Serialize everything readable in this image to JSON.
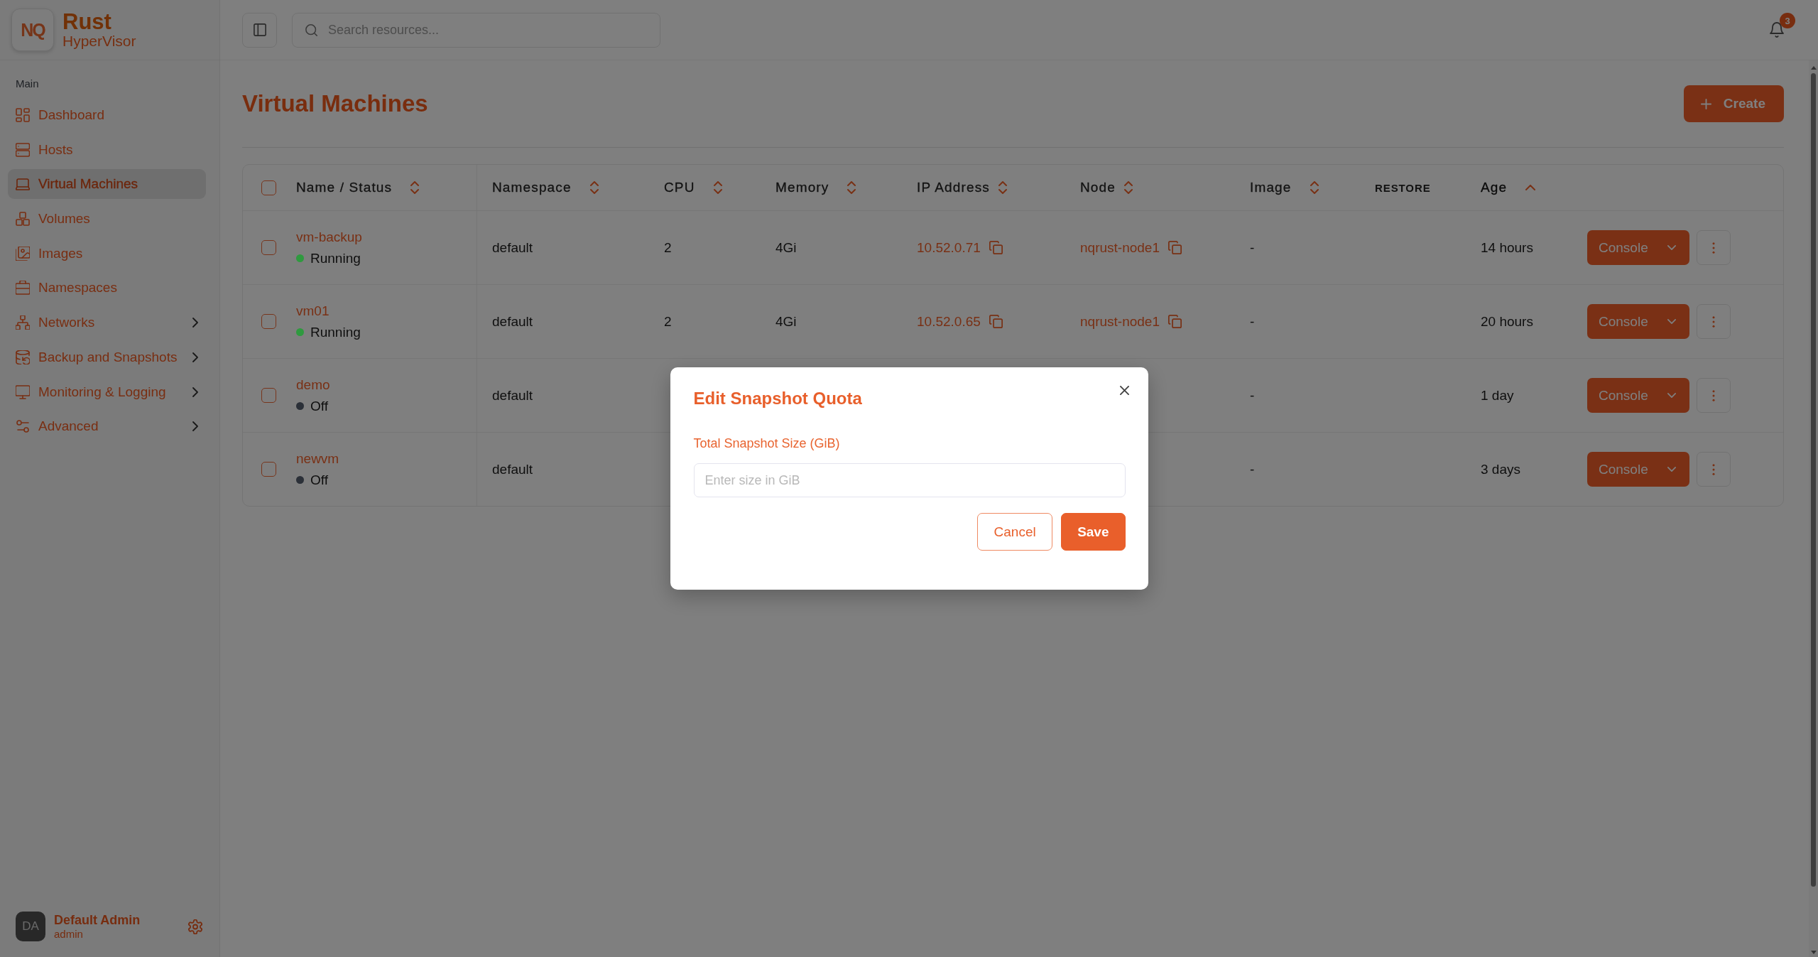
{
  "sidebar": {
    "brand": {
      "logo": "NQ",
      "name": "Rust",
      "subtitle": "HyperVisor"
    },
    "section": "Main",
    "items": [
      {
        "label": "Dashboard",
        "kind": "link",
        "selected": false
      },
      {
        "label": "Hosts",
        "kind": "link",
        "selected": false
      },
      {
        "label": "Virtual Machines",
        "kind": "link",
        "selected": true
      },
      {
        "label": "Volumes",
        "kind": "link",
        "selected": false
      },
      {
        "label": "Images",
        "kind": "link",
        "selected": false
      },
      {
        "label": "Namespaces",
        "kind": "link",
        "selected": false
      },
      {
        "label": "Networks",
        "kind": "group",
        "selected": false,
        "expanded": false
      },
      {
        "label": "Backup and Snapshots",
        "kind": "group",
        "selected": false,
        "expanded": false
      },
      {
        "label": "Monitoring & Logging",
        "kind": "group",
        "selected": false,
        "expanded": false
      },
      {
        "label": "Advanced",
        "kind": "group",
        "selected": false,
        "expanded": false
      }
    ],
    "user": {
      "initials": "DA",
      "name": "Default Admin",
      "role": "admin"
    }
  },
  "topbar": {
    "search": {
      "placeholder": "Search resources..."
    },
    "notifications": {
      "count": "3"
    }
  },
  "page": {
    "title": "Virtual Machines",
    "create_button": "Create"
  },
  "table": {
    "select_all": {
      "checked": false
    },
    "columns": [
      {
        "label": "Name / Status",
        "sortable": true,
        "sorted": false
      },
      {
        "label": "Namespace",
        "sortable": true,
        "sorted": false
      },
      {
        "label": "CPU",
        "sortable": true,
        "sorted": false
      },
      {
        "label": "Memory",
        "sortable": true,
        "sorted": false
      },
      {
        "label": "IP Address",
        "sortable": true,
        "sorted": false
      },
      {
        "label": "Node",
        "sortable": true,
        "sorted": false
      },
      {
        "label": "Image",
        "sortable": true,
        "sorted": false
      },
      {
        "label": "RESTORE",
        "sortable": false,
        "sorted": false
      },
      {
        "label": "Age",
        "sortable": true,
        "sorted": true
      }
    ],
    "rows": [
      {
        "checked": false,
        "name": "vm-backup",
        "status": {
          "label": "Running",
          "color": "#2f9a3f"
        },
        "namespace": "default",
        "cpu": "2",
        "memory": "4Gi",
        "ip": "10.52.0.71",
        "node": "nqrust-node1",
        "image": "-",
        "age": "14 hours",
        "action": "Console"
      },
      {
        "checked": false,
        "name": "vm01",
        "status": {
          "label": "Running",
          "color": "#2f9a3f"
        },
        "namespace": "default",
        "cpu": "2",
        "memory": "4Gi",
        "ip": "10.52.0.65",
        "node": "nqrust-node1",
        "image": "-",
        "age": "20 hours",
        "action": "Console"
      },
      {
        "checked": false,
        "name": "demo",
        "status": {
          "label": "Off",
          "color": "#2b3038"
        },
        "namespace": "default",
        "image": "-",
        "age": "1 day",
        "action": "Console"
      },
      {
        "checked": false,
        "name": "newvm",
        "status": {
          "label": "Off",
          "color": "#2b3038"
        },
        "namespace": "default",
        "image": "-",
        "age": "3 days",
        "action": "Console"
      }
    ]
  },
  "modal": {
    "title": "Edit Snapshot Quota",
    "field": {
      "label": "Total Snapshot Size (GiB)",
      "placeholder": "Enter size in GiB"
    },
    "buttons": [
      {
        "label": "Cancel",
        "kind": "secondary"
      },
      {
        "label": "Save",
        "kind": "primary"
      }
    ]
  }
}
